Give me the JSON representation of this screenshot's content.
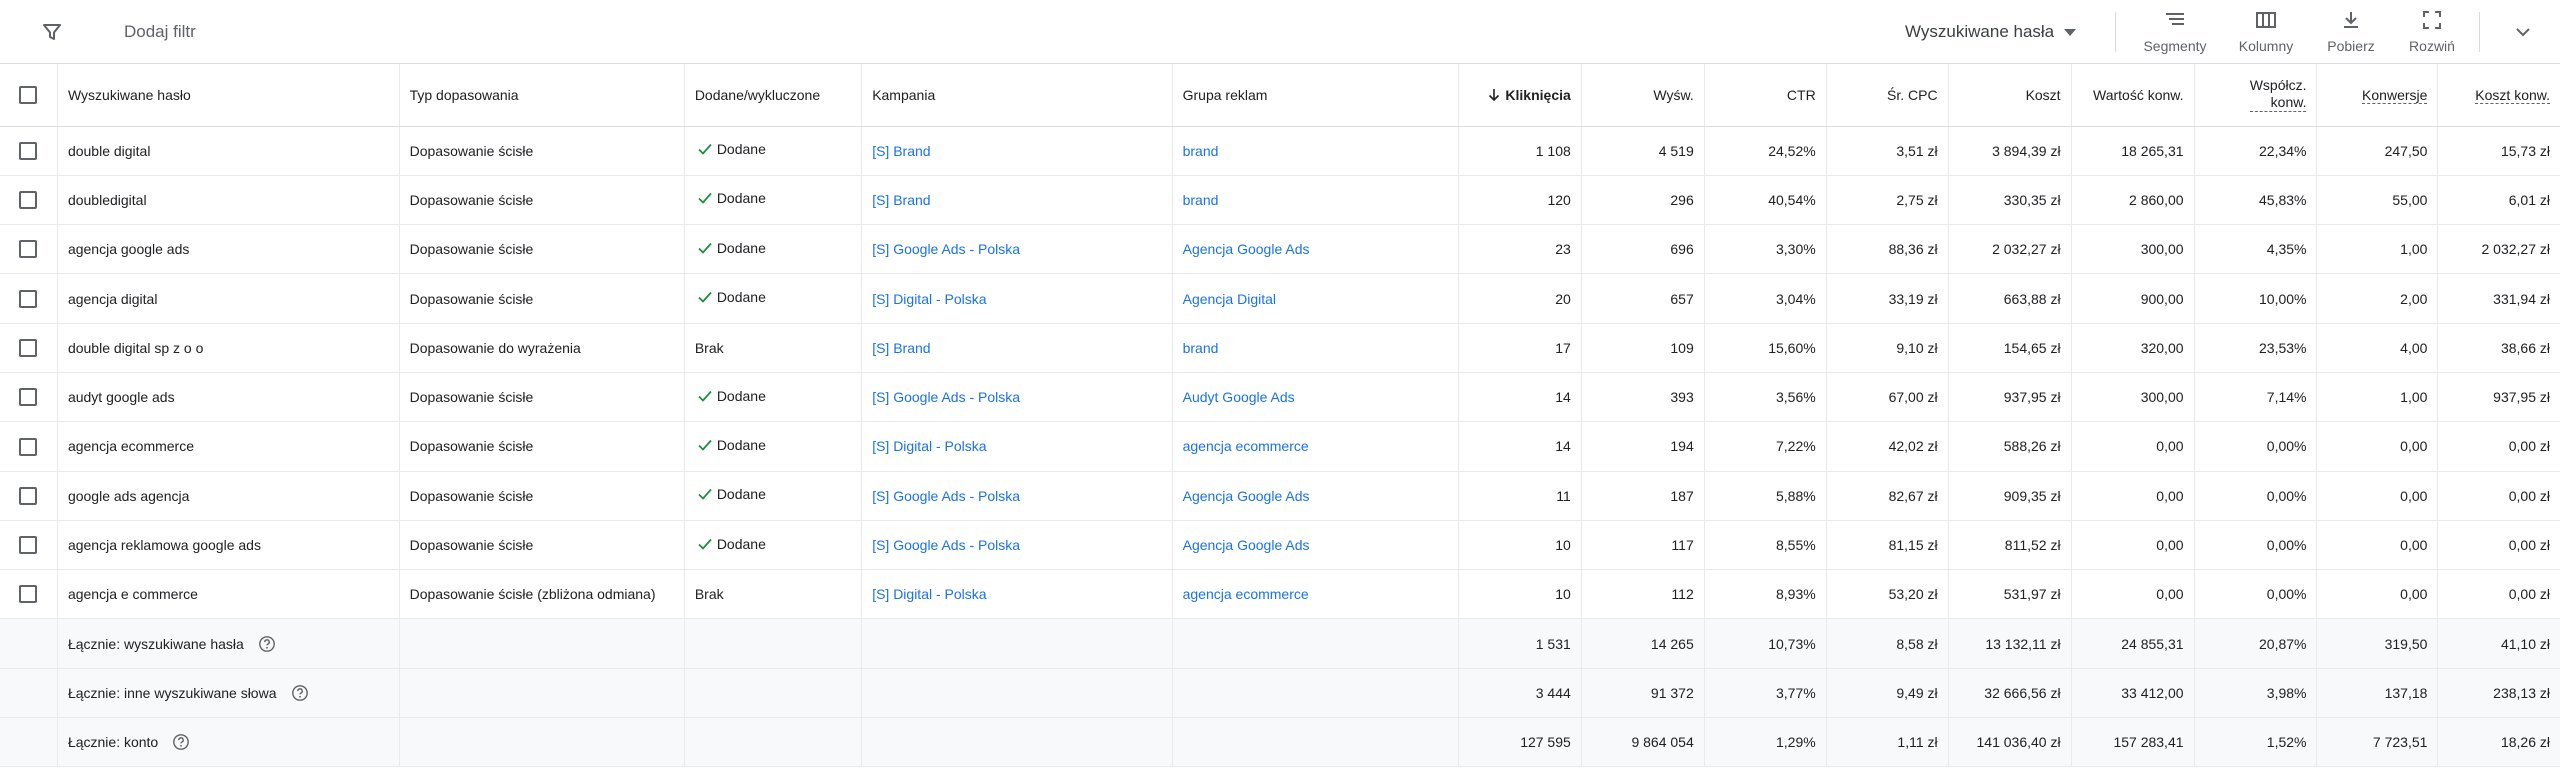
{
  "toolbar": {
    "add_filter": "Dodaj filtr",
    "view_selector": "Wyszukiwane hasła",
    "segments": "Segmenty",
    "columns": "Kolumny",
    "download": "Pobierz",
    "expand": "Rozwiń"
  },
  "table": {
    "headers": {
      "search_term": "Wyszukiwane hasło",
      "match_type": "Typ dopasowania",
      "added_excluded": "Dodane/wykluczone",
      "campaign": "Kampania",
      "ad_group": "Grupa reklam",
      "clicks": "Kliknięcia",
      "impressions": "Wyśw.",
      "ctr": "CTR",
      "avg_cpc": "Śr. CPC",
      "cost": "Koszt",
      "conv_value": "Wartość konw.",
      "conv_rate_1": "Współcz.",
      "conv_rate_2": "konw.",
      "conversions": "Konwersje",
      "cost_per_conv": "Koszt konw."
    },
    "rows": [
      {
        "term": "double digital",
        "match": "Dopasowanie ścisłe",
        "status": "Dodane",
        "status_added": true,
        "campaign": "[S] Brand",
        "ad_group": "brand",
        "clicks": "1 108",
        "impr": "4 519",
        "ctr": "24,52%",
        "cpc": "3,51 zł",
        "cost": "3 894,39 zł",
        "value": "18 265,31",
        "rate": "22,34%",
        "conv": "247,50",
        "cpconv": "15,73 zł"
      },
      {
        "term": "doubledigital",
        "match": "Dopasowanie ścisłe",
        "status": "Dodane",
        "status_added": true,
        "campaign": "[S] Brand",
        "ad_group": "brand",
        "clicks": "120",
        "impr": "296",
        "ctr": "40,54%",
        "cpc": "2,75 zł",
        "cost": "330,35 zł",
        "value": "2 860,00",
        "rate": "45,83%",
        "conv": "55,00",
        "cpconv": "6,01 zł"
      },
      {
        "term": "agencja google ads",
        "match": "Dopasowanie ścisłe",
        "status": "Dodane",
        "status_added": true,
        "campaign": "[S] Google Ads - Polska",
        "ad_group": "Agencja Google Ads",
        "clicks": "23",
        "impr": "696",
        "ctr": "3,30%",
        "cpc": "88,36 zł",
        "cost": "2 032,27 zł",
        "value": "300,00",
        "rate": "4,35%",
        "conv": "1,00",
        "cpconv": "2 032,27 zł"
      },
      {
        "term": "agencja digital",
        "match": "Dopasowanie ścisłe",
        "status": "Dodane",
        "status_added": true,
        "campaign": "[S] Digital - Polska",
        "ad_group": "Agencja Digital",
        "clicks": "20",
        "impr": "657",
        "ctr": "3,04%",
        "cpc": "33,19 zł",
        "cost": "663,88 zł",
        "value": "900,00",
        "rate": "10,00%",
        "conv": "2,00",
        "cpconv": "331,94 zł"
      },
      {
        "term": "double digital sp z o o",
        "match": "Dopasowanie do wyrażenia",
        "status": "Brak",
        "status_added": false,
        "campaign": "[S] Brand",
        "ad_group": "brand",
        "clicks": "17",
        "impr": "109",
        "ctr": "15,60%",
        "cpc": "9,10 zł",
        "cost": "154,65 zł",
        "value": "320,00",
        "rate": "23,53%",
        "conv": "4,00",
        "cpconv": "38,66 zł"
      },
      {
        "term": "audyt google ads",
        "match": "Dopasowanie ścisłe",
        "status": "Dodane",
        "status_added": true,
        "campaign": "[S] Google Ads - Polska",
        "ad_group": "Audyt Google Ads",
        "clicks": "14",
        "impr": "393",
        "ctr": "3,56%",
        "cpc": "67,00 zł",
        "cost": "937,95 zł",
        "value": "300,00",
        "rate": "7,14%",
        "conv": "1,00",
        "cpconv": "937,95 zł"
      },
      {
        "term": "agencja ecommerce",
        "match": "Dopasowanie ścisłe",
        "status": "Dodane",
        "status_added": true,
        "campaign": "[S] Digital - Polska",
        "ad_group": "agencja ecommerce",
        "clicks": "14",
        "impr": "194",
        "ctr": "7,22%",
        "cpc": "42,02 zł",
        "cost": "588,26 zł",
        "value": "0,00",
        "rate": "0,00%",
        "conv": "0,00",
        "cpconv": "0,00 zł"
      },
      {
        "term": "google ads agencja",
        "match": "Dopasowanie ścisłe",
        "status": "Dodane",
        "status_added": true,
        "campaign": "[S] Google Ads - Polska",
        "ad_group": "Agencja Google Ads",
        "clicks": "11",
        "impr": "187",
        "ctr": "5,88%",
        "cpc": "82,67 zł",
        "cost": "909,35 zł",
        "value": "0,00",
        "rate": "0,00%",
        "conv": "0,00",
        "cpconv": "0,00 zł"
      },
      {
        "term": "agencja reklamowa google ads",
        "match": "Dopasowanie ścisłe",
        "status": "Dodane",
        "status_added": true,
        "campaign": "[S] Google Ads - Polska",
        "ad_group": "Agencja Google Ads",
        "clicks": "10",
        "impr": "117",
        "ctr": "8,55%",
        "cpc": "81,15 zł",
        "cost": "811,52 zł",
        "value": "0,00",
        "rate": "0,00%",
        "conv": "0,00",
        "cpconv": "0,00 zł"
      },
      {
        "term": "agencja e commerce",
        "match": "Dopasowanie ścisłe (zbliżona odmiana)",
        "status": "Brak",
        "status_added": false,
        "campaign": "[S] Digital - Polska",
        "ad_group": "agencja ecommerce",
        "clicks": "10",
        "impr": "112",
        "ctr": "8,93%",
        "cpc": "53,20 zł",
        "cost": "531,97 zł",
        "value": "0,00",
        "rate": "0,00%",
        "conv": "0,00",
        "cpconv": "0,00 zł"
      }
    ],
    "totals": [
      {
        "label": "Łącznie: wyszukiwane hasła",
        "clicks": "1 531",
        "impr": "14 265",
        "ctr": "10,73%",
        "cpc": "8,58 zł",
        "cost": "13 132,11 zł",
        "value": "24 855,31",
        "rate": "20,87%",
        "conv": "319,50",
        "cpconv": "41,10 zł"
      },
      {
        "label": "Łącznie: inne wyszukiwane słowa",
        "clicks": "3 444",
        "impr": "91 372",
        "ctr": "3,77%",
        "cpc": "9,49 zł",
        "cost": "32 666,56 zł",
        "value": "33 412,00",
        "rate": "3,98%",
        "conv": "137,18",
        "cpconv": "238,13 zł"
      },
      {
        "label": "Łącznie: konto",
        "clicks": "127 595",
        "impr": "9 864 054",
        "ctr": "1,29%",
        "cpc": "1,11 zł",
        "cost": "141 036,40 zł",
        "value": "157 283,41",
        "rate": "1,52%",
        "conv": "7 723,51",
        "cpconv": "18,26 zł"
      }
    ]
  },
  "colors": {
    "link": "#1a73e8",
    "check_green": "#1e8e3e",
    "border": "#e8eaed",
    "total_bg": "#f8f9fa"
  },
  "icons": {
    "filter": "filter-icon",
    "segments": "segments-icon",
    "columns": "columns-icon",
    "download": "download-icon",
    "expand": "fullscreen-icon",
    "more": "chevron-down-icon",
    "status": "check-icon",
    "help": "help-circle-icon",
    "sort": "arrow-down-icon"
  }
}
